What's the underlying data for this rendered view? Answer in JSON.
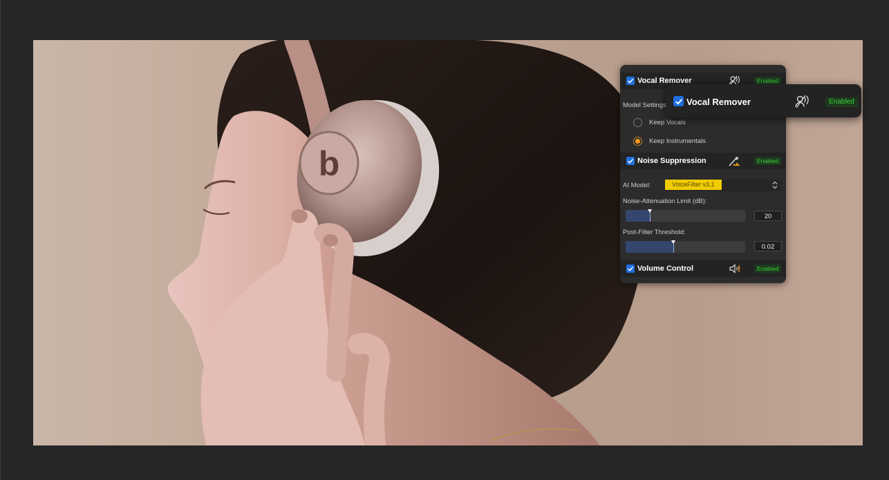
{
  "panel": {
    "vocal": {
      "title": "Vocal Remover",
      "status": "Enabled",
      "icon": "vocal-remover-icon",
      "model_settings_label": "Model Settings:",
      "options": [
        {
          "label": "Keep Vocals",
          "selected": false
        },
        {
          "label": "Keep Instrumentals",
          "selected": true
        }
      ]
    },
    "noise": {
      "title": "Noise Suppression",
      "status": "Enabled",
      "icon": "magic-wand-icon",
      "ai_model_label": "AI Model:",
      "ai_model_value": "VoiceFilter v3.1",
      "attenuation_label": "Noise-Attenuation Limit (dB):",
      "attenuation_value": "20",
      "attenuation_fraction": 0.2,
      "threshold_label": "Post-Filter Threshold:",
      "threshold_value": "0.02",
      "threshold_fraction": 0.4
    },
    "volume": {
      "title": "Volume Control",
      "status": "Enabled",
      "icon": "speaker-icon"
    }
  },
  "zoom_card": {
    "title": "Vocal Remover",
    "status": "Enabled"
  },
  "colors": {
    "accent_check": "#1f6fe0",
    "enabled_text": "#39d039",
    "radio_selected": "#ff9a1a",
    "select_highlight": "#f0cc00",
    "slider_fill": "#34466e"
  }
}
